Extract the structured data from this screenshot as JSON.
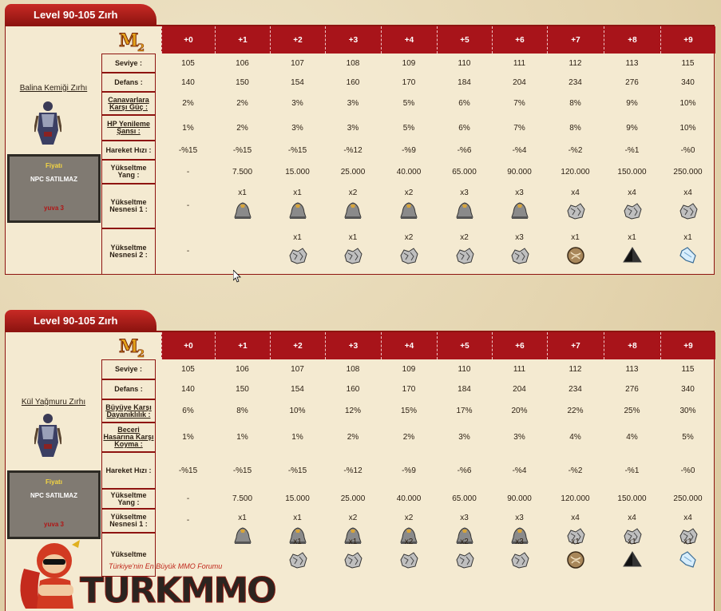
{
  "panels": [
    {
      "tab_title": "Level 90-105 Zırh",
      "item_name": "Balina Kemiği Zırhı",
      "price": {
        "label": "Fiyatı",
        "value": "NPC SATILMAZ",
        "tag": "yuva 3"
      },
      "upgrade_headers": [
        "+0",
        "+1",
        "+2",
        "+3",
        "+4",
        "+5",
        "+6",
        "+7",
        "+8",
        "+9"
      ],
      "rows": [
        {
          "label": "Seviye :",
          "underline": false,
          "values": [
            "105",
            "106",
            "107",
            "108",
            "109",
            "110",
            "111",
            "112",
            "113",
            "115"
          ]
        },
        {
          "label": "Defans :",
          "underline": false,
          "values": [
            "140",
            "150",
            "154",
            "160",
            "170",
            "184",
            "204",
            "234",
            "276",
            "340"
          ]
        },
        {
          "label": "Canavarlara Karşı Güç :",
          "underline": true,
          "values": [
            "2%",
            "2%",
            "3%",
            "3%",
            "5%",
            "6%",
            "7%",
            "8%",
            "9%",
            "10%"
          ]
        },
        {
          "label": "HP Yenileme Şansı :",
          "underline": true,
          "values": [
            "1%",
            "2%",
            "3%",
            "3%",
            "5%",
            "6%",
            "7%",
            "8%",
            "9%",
            "10%"
          ]
        },
        {
          "label": "Hareket Hızı :",
          "underline": false,
          "values": [
            "-%15",
            "-%15",
            "-%15",
            "-%12",
            "-%9",
            "-%6",
            "-%4",
            "-%2",
            "-%1",
            "-%0"
          ]
        },
        {
          "label": "Yükseltme Yang :",
          "underline": false,
          "values": [
            "-",
            "7.500",
            "15.000",
            "25.000",
            "40.000",
            "65.000",
            "90.000",
            "120.000",
            "150.000",
            "250.000"
          ]
        }
      ],
      "materials": [
        {
          "label": "Yükseltme Nesnesi 1 :",
          "items": [
            {
              "q": "-",
              "i": ""
            },
            {
              "q": "x1",
              "i": "bell-icon"
            },
            {
              "q": "x1",
              "i": "bell-icon"
            },
            {
              "q": "x2",
              "i": "bell-icon"
            },
            {
              "q": "x2",
              "i": "bell-icon"
            },
            {
              "q": "x3",
              "i": "bell-icon"
            },
            {
              "q": "x3",
              "i": "bell-icon"
            },
            {
              "q": "x4",
              "i": "ore-icon"
            },
            {
              "q": "x4",
              "i": "ore-icon"
            },
            {
              "q": "x4",
              "i": "ore-icon"
            }
          ]
        },
        {
          "label": "Yükseltme Nesnesi 2 :",
          "items": [
            {
              "q": "-",
              "i": ""
            },
            {
              "q": "",
              "i": ""
            },
            {
              "q": "x1",
              "i": "ore-icon"
            },
            {
              "q": "x1",
              "i": "ore-icon"
            },
            {
              "q": "x2",
              "i": "ore-icon"
            },
            {
              "q": "x2",
              "i": "ore-icon"
            },
            {
              "q": "x3",
              "i": "ore-icon"
            },
            {
              "q": "x1",
              "i": "orb-icon"
            },
            {
              "q": "x1",
              "i": "pyramid-icon"
            },
            {
              "q": "x1",
              "i": "crystal-icon"
            }
          ]
        }
      ]
    },
    {
      "tab_title": "Level 90-105 Zırh",
      "item_name": "Kül Yağmuru Zırhı",
      "price": {
        "label": "Fiyatı",
        "value": "NPC SATILMAZ",
        "tag": "yuva 3"
      },
      "upgrade_headers": [
        "+0",
        "+1",
        "+2",
        "+3",
        "+4",
        "+5",
        "+6",
        "+7",
        "+8",
        "+9"
      ],
      "rows": [
        {
          "label": "Seviye :",
          "underline": false,
          "values": [
            "105",
            "106",
            "107",
            "108",
            "109",
            "110",
            "111",
            "112",
            "113",
            "115"
          ]
        },
        {
          "label": "Defans :",
          "underline": false,
          "values": [
            "140",
            "150",
            "154",
            "160",
            "170",
            "184",
            "204",
            "234",
            "276",
            "340"
          ]
        },
        {
          "label": "Büyüye Karşı Dayanıklılık :",
          "underline": true,
          "values": [
            "6%",
            "8%",
            "10%",
            "12%",
            "15%",
            "17%",
            "20%",
            "22%",
            "25%",
            "30%"
          ]
        },
        {
          "label": "Beceri Hasarına Karşı Koyma :",
          "underline": true,
          "values": [
            "1%",
            "1%",
            "1%",
            "2%",
            "2%",
            "3%",
            "3%",
            "4%",
            "4%",
            "5%"
          ]
        },
        {
          "label": "Hareket Hızı :",
          "underline": false,
          "values": [
            "-%15",
            "-%15",
            "-%15",
            "-%12",
            "-%9",
            "-%6",
            "-%4",
            "-%2",
            "-%1",
            "-%0"
          ]
        },
        {
          "label": "Yükseltme Yang :",
          "underline": false,
          "values": [
            "-",
            "7.500",
            "15.000",
            "25.000",
            "40.000",
            "65.000",
            "90.000",
            "120.000",
            "150.000",
            "250.000"
          ]
        }
      ],
      "materials": [
        {
          "label": "Yükseltme Nesnesi 1 :",
          "items": [
            {
              "q": "-",
              "i": ""
            },
            {
              "q": "x1",
              "i": "bell-icon"
            },
            {
              "q": "x1",
              "i": "bell-icon"
            },
            {
              "q": "x2",
              "i": "bell-icon"
            },
            {
              "q": "x2",
              "i": "bell-icon"
            },
            {
              "q": "x3",
              "i": "bell-icon"
            },
            {
              "q": "x3",
              "i": "bell-icon"
            },
            {
              "q": "x4",
              "i": "ore-icon"
            },
            {
              "q": "x4",
              "i": "ore-icon"
            },
            {
              "q": "x4",
              "i": "ore-icon"
            }
          ]
        },
        {
          "label": "Yükseltme",
          "items": [
            {
              "q": "",
              "i": ""
            },
            {
              "q": "",
              "i": ""
            },
            {
              "q": "x1",
              "i": "ore-icon"
            },
            {
              "q": "x1",
              "i": "ore-icon"
            },
            {
              "q": "x2",
              "i": "ore-icon"
            },
            {
              "q": "x2",
              "i": "ore-icon"
            },
            {
              "q": "x3",
              "i": "ore-icon"
            },
            {
              "q": "x1",
              "i": "orb-icon"
            },
            {
              "q": "x1",
              "i": "pyramid-icon"
            },
            {
              "q": "x1",
              "i": "crystal-icon"
            }
          ]
        }
      ]
    }
  ],
  "watermark": {
    "tagline": "Türkiye'nin En Büyük MMO Forumu",
    "brand": "TURKMMO"
  }
}
